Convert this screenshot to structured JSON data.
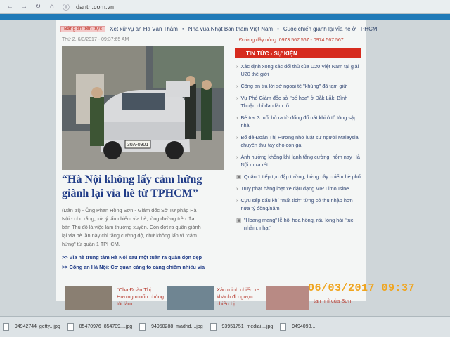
{
  "browser": {
    "url": "dantri.com.vn"
  },
  "topnews": {
    "badge": "Bảng tin trên trực",
    "items": [
      "Xét xử vụ án Hà Văn Thắm",
      "Nhà vua Nhật Bản thăm Việt Nam",
      "Cuộc chiến giành lại vỉa hè ở TPHCM"
    ]
  },
  "article": {
    "date": "Thứ 2, 6/3/2017 - 09:37:65 AM",
    "title": "“Hà Nội không lấy cảm hứng giành lại vỉa hè từ TPHCM”",
    "lead_lines": [
      "(Dân trí) - Ông Phan Hồng Sơn - Giám đốc Sở Tư pháp Hà",
      "Nội - cho rằng, xử lý lấn chiếm vỉa hè, lòng đường trên địa",
      "bàn Thủ đô là việc làm thường xuyên. Còn đợt ra quân giành",
      "lại vỉa hè lần này chỉ tăng cường độ, chứ không lấn vì \"cảm",
      "hứng\" từ quận 1 TPHCM."
    ],
    "related": [
      ">> Vỉa hè trung tâm Hà Nội sau một tuần ra quân dọn dẹp",
      ">> Công an Hà Nội: Cơ quan càng to càng chiếm nhiều vỉa"
    ],
    "plate": "30A-0901"
  },
  "sidebar": {
    "hotline": "Đường dây nóng: 0973 567 567 - 0974 567 567",
    "heading": "TIN TỨC - SỰ KIỆN",
    "items": [
      "Xác định xong các đối thủ của U20 Việt Nam tại giải U20 thế giới",
      "Công an trả lời sở ngoại tệ \"khủng\" đã tạm giữ",
      "Vụ Phó Giám đốc sở \"bé hoa\" ở Đắk Lắk: Bình Thuận chỉ đạo làm rõ",
      "Bé trai 3 tuổi bỏ ra từ đống đổ nát khi ô tô tông sập nhà",
      "Bố đẻ Đoàn Thị Hương nhờ luật sư người Malaysia chuyển thư tay cho con gái",
      "Ảnh hưởng không khí lạnh tăng cường, hôm nay Hà Nội mưa rét",
      "Quận 1 tiếp tục đập tường, bứng cây chiếm hè phố",
      "Truy phạt hàng loạt xe đậu dạng VIP Limousine",
      "Cựu sếp đấu khí \"mất tích\" từng có thu nhập hơn nửa tỷ đồng/năm",
      "\"Hoang mang\" lễ hội hoa hồng, rầu lòng hái \"tục, nhảm, nhạt\""
    ]
  },
  "bottom_strip": {
    "captions": [
      "\"Cha Đoàn Thị Hương muốn chúng tôi làm",
      "Xác minh chiếc xe khách đi ngược chiều bị",
      "tan nhì của Sơn"
    ]
  },
  "timestamp": "06/03/2017 09:37",
  "downloads": {
    "files": [
      "_94942744_getty...jpg",
      "_85470976_854709....jpg",
      "_94950288_madrid....jpg",
      "_93951751_mediai....jpg",
      "_9494093..."
    ]
  },
  "colors": {
    "accent_red": "#d62b1e",
    "link_blue": "#1f3b87",
    "nav_blue": "#1f7ab8",
    "stamp_orange": "#f0a51f"
  }
}
